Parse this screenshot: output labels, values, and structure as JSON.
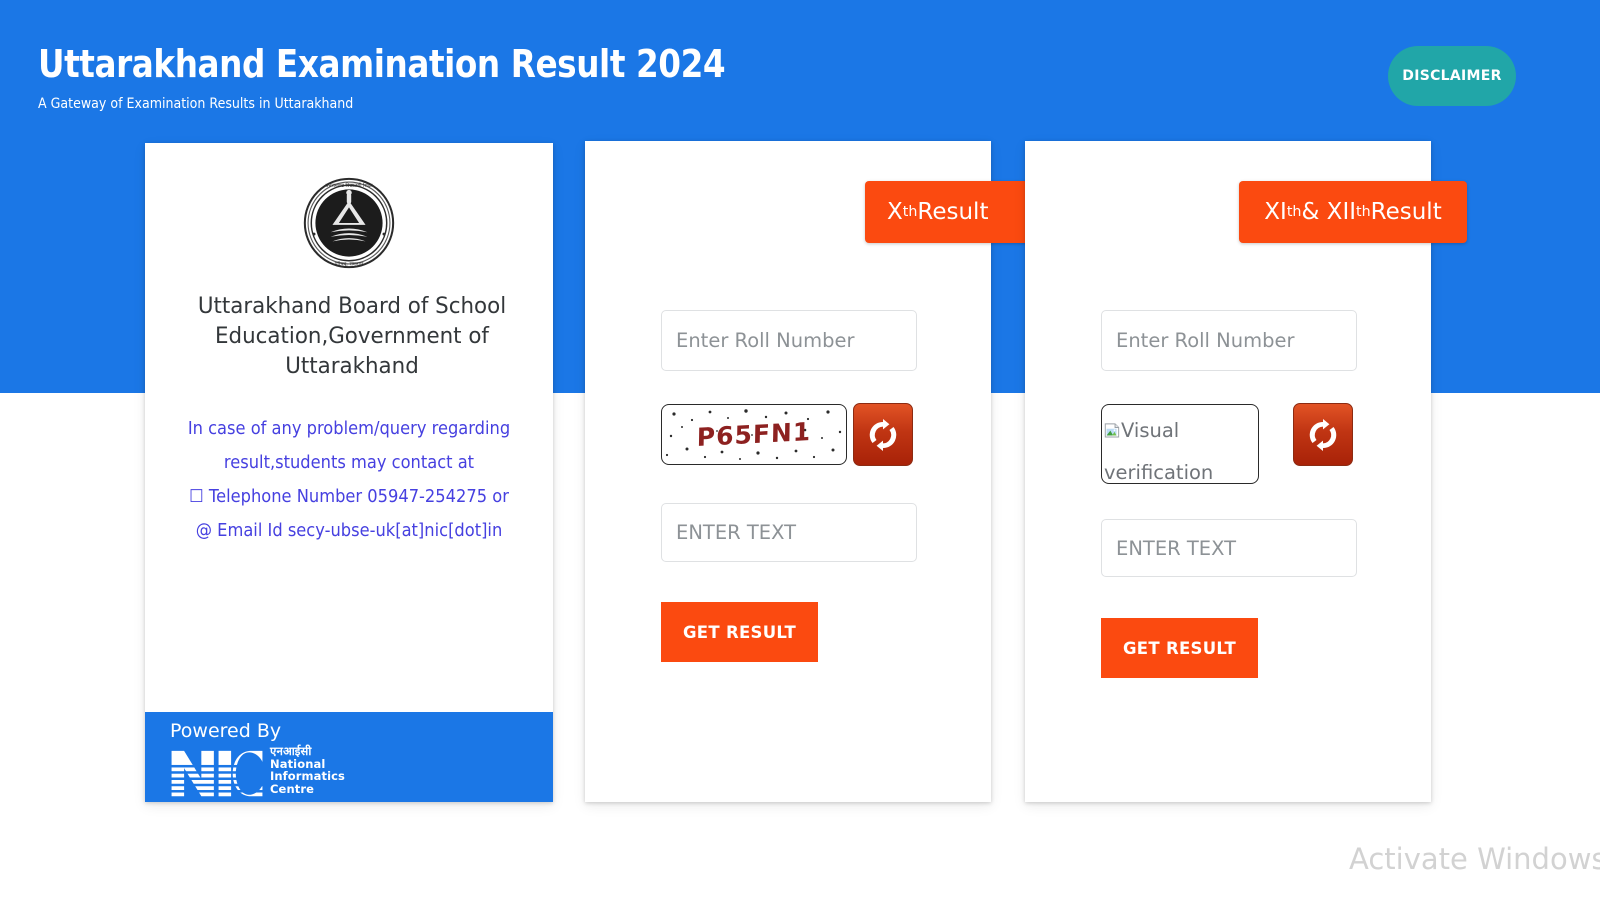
{
  "header": {
    "title": "Uttarakhand Examination Result 2024",
    "subtitle": "A Gateway of Examination Results in Uttarakhand",
    "disclaimer_label": "DISCLAIMER",
    "background_color": "#1b77e6",
    "disclaimer_color": "#21a6a8"
  },
  "board_card": {
    "logo_name": "uttarakhand-board-emblem",
    "board_name": "Uttarakhand Board of School Education,Government of Uttarakhand",
    "contact": {
      "line1": "In case of any problem/query regarding",
      "line2": "result,students may contact at",
      "phone_glyph": "☐",
      "line3": "Telephone Number 05947-254275 or",
      "email_glyph": "@",
      "line4": "Email Id secy-ubse-uk[at]nic[dot]in",
      "text_color": "#4640e0"
    },
    "footer": {
      "powered_by": "Powered By",
      "logo_letters": "NIC",
      "hindi": "एनआईसी",
      "line1": "National",
      "line2": "Informatics",
      "line3": "Centre"
    }
  },
  "tenth_card": {
    "tab_prefix": "X",
    "tab_sup": "th",
    "tab_suffix": " Result",
    "roll_placeholder": "Enter Roll Number",
    "roll_value": "",
    "captcha_text": "P65FN1",
    "refresh_icon": "refresh-icon",
    "text_placeholder": "ENTER TEXT",
    "text_value": "",
    "submit_label": "GET RESULT"
  },
  "eleventh_card": {
    "tab_prefix": "XI",
    "tab_sup1": "th",
    "tab_middle": " & XII",
    "tab_sup2": "th",
    "tab_suffix": " Result",
    "roll_placeholder": "Enter Roll Number",
    "roll_value": "",
    "captcha_alt": "Visual verification",
    "refresh_icon": "refresh-icon",
    "text_placeholder": "ENTER TEXT",
    "text_value": "",
    "submit_label": "GET RESULT"
  },
  "watermark": {
    "text": "Activate Windows"
  },
  "colors": {
    "brand_blue": "#1b77e6",
    "accent_orange": "#fb4a10",
    "teal": "#21a6a8",
    "captcha_red": "#8d2120"
  }
}
